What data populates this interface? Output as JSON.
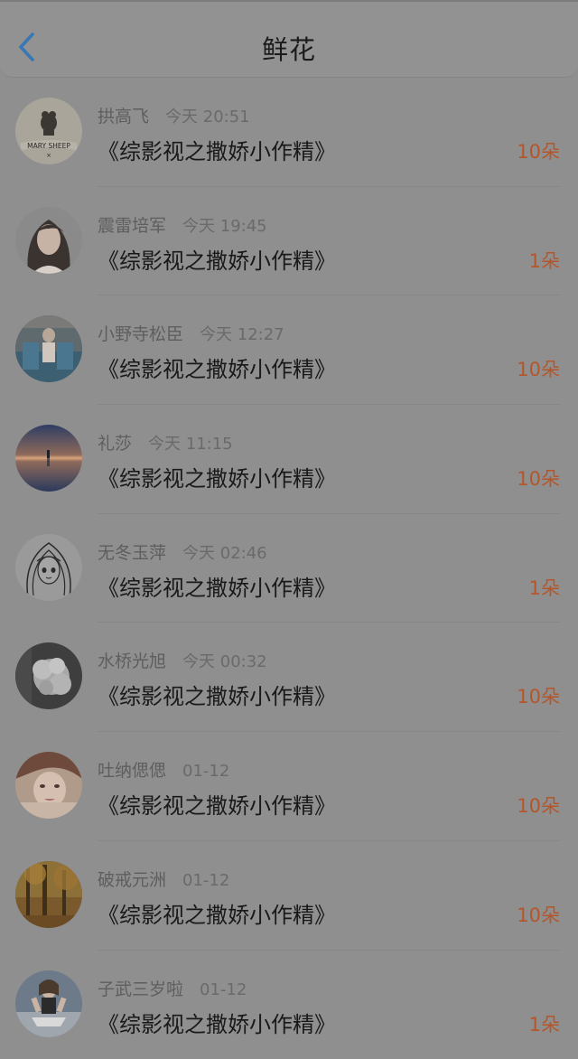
{
  "header": {
    "title": "鲜花",
    "back_icon": "chevron-left-icon",
    "accent_color": "#3a78b5"
  },
  "list": [
    {
      "user": "拱高飞",
      "time": "今天 20:51",
      "book": "《综影视之撒娇小作精》",
      "count": "10朵",
      "avatar_label": "MARY SHEEP",
      "avatar": "mary-sheep-logo"
    },
    {
      "user": "震雷培军",
      "time": "今天 19:45",
      "book": "《综影视之撒娇小作精》",
      "count": "1朵",
      "avatar": "woman-portrait"
    },
    {
      "user": "小野寺松臣",
      "time": "今天 12:27",
      "book": "《综影视之撒娇小作精》",
      "count": "10朵",
      "avatar": "figure-blue-seat"
    },
    {
      "user": "礼莎",
      "time": "今天 11:15",
      "book": "《综影视之撒娇小作精》",
      "count": "10朵",
      "avatar": "sunset-reflection"
    },
    {
      "user": "无冬玉萍",
      "time": "今天 02:46",
      "book": "《综影视之撒娇小作精》",
      "count": "1朵",
      "avatar": "anime-girl-sketch"
    },
    {
      "user": "水桥光旭",
      "time": "今天 00:32",
      "book": "《综影视之撒娇小作精》",
      "count": "10朵",
      "avatar": "white-flowers"
    },
    {
      "user": "吐纳偲偲",
      "time": "01-12",
      "book": "《综影视之撒娇小作精》",
      "count": "10朵",
      "avatar": "woman-closeup"
    },
    {
      "user": "破戒元洲",
      "time": "01-12",
      "book": "《综影视之撒娇小作精》",
      "count": "10朵",
      "avatar": "autumn-forest"
    },
    {
      "user": "子武三岁啦",
      "time": "01-12",
      "book": "《综影视之撒娇小作精》",
      "count": "1朵",
      "avatar": "girl-sitting"
    }
  ]
}
